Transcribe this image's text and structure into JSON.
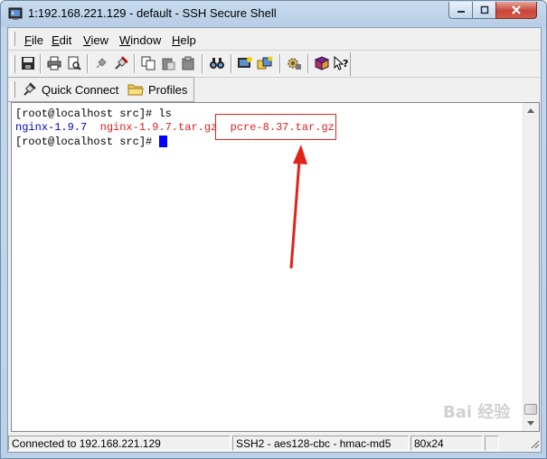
{
  "window": {
    "title": "1:192.168.221.129 - default - SSH Secure Shell",
    "controls": [
      "minimize-icon",
      "maximize-icon",
      "close-icon"
    ]
  },
  "menubar": {
    "items": [
      {
        "label": "File",
        "accel": "F"
      },
      {
        "label": "Edit",
        "accel": "E"
      },
      {
        "label": "View",
        "accel": "V"
      },
      {
        "label": "Window",
        "accel": "W"
      },
      {
        "label": "Help",
        "accel": "H"
      }
    ]
  },
  "toolbar": {
    "buttons": [
      "save-icon",
      "print-icon",
      "print-preview-icon",
      "disconnect-icon",
      "connect-icon",
      "copy-icon",
      "paste-icon",
      "paste-alt-icon",
      "find-icon",
      "new-terminal-icon",
      "new-file-transfer-icon",
      "settings-icon",
      "help-book-icon",
      "context-help-icon"
    ]
  },
  "quickbar": {
    "quick_connect": "Quick Connect",
    "profiles": "Profiles"
  },
  "terminal": {
    "line1": "[root@localhost src]# ls",
    "line2_dir": "nginx-1.9.7",
    "line2_file1": "nginx-1.9.7.tar.gz",
    "line2_file2": "pcre-8.37.tar.gz",
    "line3": "[root@localhost src]# ",
    "colors": {
      "default": "#000000",
      "directory": "#0000c0",
      "archive": "#e0201a",
      "cursor": "#0000ff"
    }
  },
  "annotation": {
    "color": "#e2231a"
  },
  "statusbar": {
    "connection": "Connected to 192.168.221.129",
    "cipher": "SSH2 - aes128-cbc - hmac-md5",
    "size": "80x24"
  },
  "watermark": "Bai 经验"
}
